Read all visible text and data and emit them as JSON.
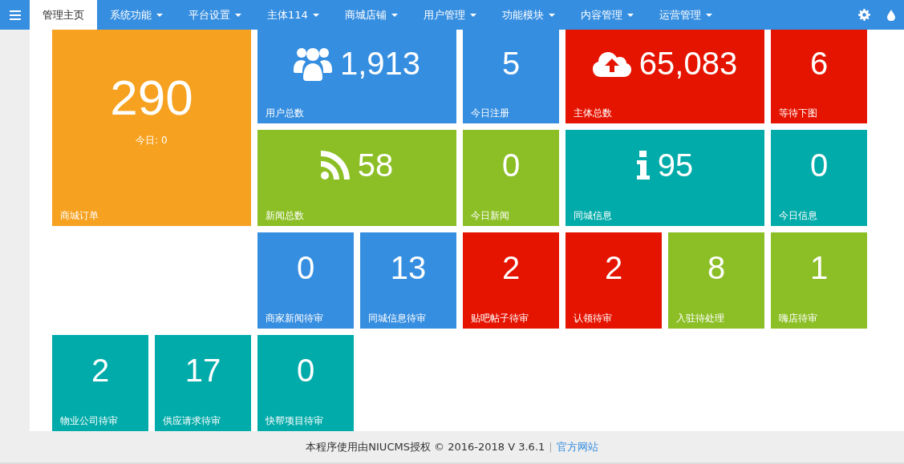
{
  "nav": {
    "items": [
      {
        "label": "管理主页",
        "selected": true,
        "dropdown": false
      },
      {
        "label": "系统功能",
        "selected": false,
        "dropdown": true
      },
      {
        "label": "平台设置",
        "selected": false,
        "dropdown": true
      },
      {
        "label": "主体114",
        "selected": false,
        "dropdown": true
      },
      {
        "label": "商城店铺",
        "selected": false,
        "dropdown": true
      },
      {
        "label": "用户管理",
        "selected": false,
        "dropdown": true
      },
      {
        "label": "功能模块",
        "selected": false,
        "dropdown": true
      },
      {
        "label": "内容管理",
        "selected": false,
        "dropdown": true
      },
      {
        "label": "运营管理",
        "selected": false,
        "dropdown": true
      }
    ]
  },
  "feature_tile": {
    "value": "290",
    "sub": "今日: 0",
    "label": "商城订单",
    "color": "#f6a11f"
  },
  "grid_tiles": [
    {
      "kind": "wide",
      "value": "1,913",
      "label": "用户总数",
      "color": "#368ee0"
    },
    {
      "kind": "small",
      "value": "5",
      "label": "今日注册",
      "color": "#368ee0"
    },
    {
      "kind": "wide",
      "value": "65,083",
      "label": "主体总数",
      "color": "#e51400"
    },
    {
      "kind": "small",
      "value": "6",
      "label": "等待下图",
      "color": "#e51400"
    },
    {
      "kind": "wide",
      "value": "58",
      "label": "新闻总数",
      "color": "#8cbf26"
    },
    {
      "kind": "small",
      "value": "0",
      "label": "今日新闻",
      "color": "#8cbf26"
    },
    {
      "kind": "wide",
      "value": "95",
      "label": "同城信息",
      "color": "#00aba9"
    },
    {
      "kind": "small",
      "value": "0",
      "label": "今日信息",
      "color": "#00aba9"
    },
    {
      "kind": "small",
      "value": "0",
      "label": "商家新闻待审",
      "color": "#368ee0"
    },
    {
      "kind": "small",
      "value": "13",
      "label": "同城信息待审",
      "color": "#368ee0"
    },
    {
      "kind": "small",
      "value": "2",
      "label": "贴吧帖子待审",
      "color": "#e51400"
    },
    {
      "kind": "small",
      "value": "2",
      "label": "认领待审",
      "color": "#e51400"
    },
    {
      "kind": "small",
      "value": "8",
      "label": "入驻待处理",
      "color": "#8cbf26"
    },
    {
      "kind": "small",
      "value": "1",
      "label": "嗨店待审",
      "color": "#8cbf26"
    }
  ],
  "bottom_tiles": [
    {
      "value": "2",
      "label": "物业公司待审",
      "color": "#00aba9"
    },
    {
      "value": "17",
      "label": "供应请求待审",
      "color": "#00aba9"
    },
    {
      "value": "0",
      "label": "快帮项目待审",
      "color": "#00aba9"
    }
  ],
  "footer": {
    "text": "本程序使用由NIUCMS授权 © 2016-2018 V 3.6.1",
    "separator": "|",
    "link": "官方网站"
  }
}
